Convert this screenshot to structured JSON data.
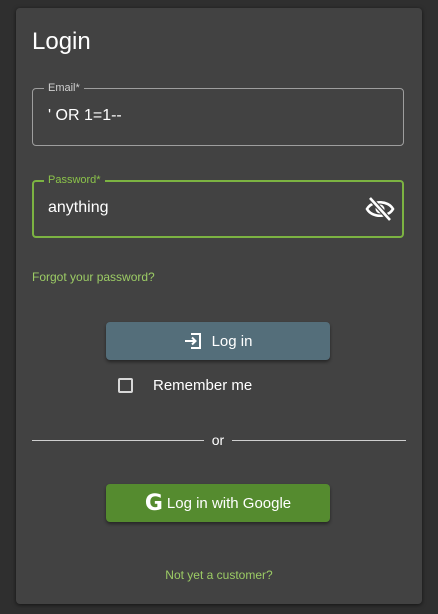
{
  "form": {
    "title": "Login",
    "email": {
      "label": "Email*",
      "value": "' OR 1=1--"
    },
    "password": {
      "label": "Password*",
      "value": "anything",
      "visibility_icon": "eye-off-icon"
    },
    "forgot_link": "Forgot your password?",
    "login_button": {
      "label": "Log in",
      "icon": "login-icon"
    },
    "remember": {
      "label": "Remember me",
      "checked": false
    },
    "divider_text": "or",
    "google_button": {
      "label": "Log in with Google",
      "icon_glyph": "G"
    },
    "signup_link": "Not yet a customer?"
  },
  "colors": {
    "background": "#2f2f2f",
    "card": "#424242",
    "accent_green": "#7cb342",
    "link_green": "#9ccc65",
    "login_button": "#546e7a",
    "google_button": "#558b2f"
  }
}
